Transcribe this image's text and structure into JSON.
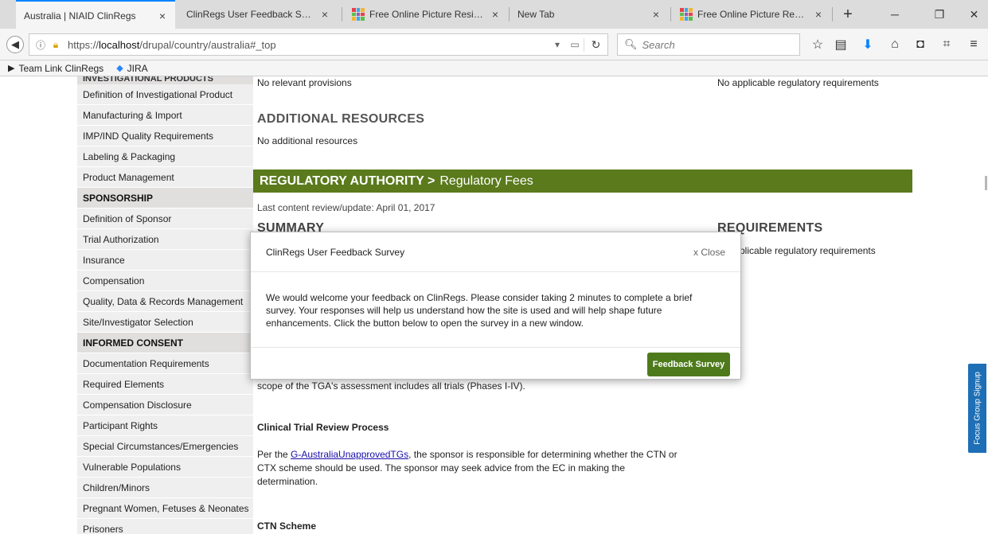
{
  "browser": {
    "tabs": [
      {
        "title": "Australia | NIAID ClinRegs",
        "active": true
      },
      {
        "title": "ClinRegs User Feedback Surve...",
        "active": false
      },
      {
        "title": "Free Online Picture Resize...",
        "active": false,
        "favicon": "grid-icon"
      },
      {
        "title": "New Tab",
        "active": false
      },
      {
        "title": "Free Online Picture Resize...",
        "active": false,
        "favicon": "grid-icon"
      }
    ],
    "close_glyph": "×",
    "new_tab_glyph": "+",
    "url_prefix": "https://",
    "url_host": "localhost",
    "url_path": "/drupal/country/australia#_top",
    "search_placeholder": "Search",
    "bookmarks": [
      {
        "label": "Team Link ClinRegs",
        "icon": "arrow-folder-icon"
      },
      {
        "label": "JIRA",
        "icon": "jira-diamond-icon"
      }
    ]
  },
  "sidebar": {
    "cut_header": "INVESTIGATIONAL PRODUCTS",
    "items_a": [
      "Definition of Investigational Product",
      "Manufacturing & Import",
      "IMP/IND Quality Requirements",
      "Labeling & Packaging",
      "Product Management"
    ],
    "header_sponsorship": "SPONSORSHIP",
    "items_b": [
      "Definition of Sponsor",
      "Trial Authorization",
      "Insurance",
      "Compensation",
      "Quality, Data & Records Management",
      "Site/Investigator Selection"
    ],
    "header_consent": "INFORMED CONSENT",
    "items_c": [
      "Documentation Requirements",
      "Required Elements",
      "Compensation Disclosure",
      "Participant Rights",
      "Special Circumstances/Emergencies",
      "Vulnerable Populations",
      "Children/Minors",
      "Pregnant Women, Fetuses & Neonates",
      "Prisoners"
    ]
  },
  "main": {
    "no_provisions": "No relevant provisions",
    "no_requirements_top": "No applicable regulatory requirements",
    "additional_resources_heading": "ADDITIONAL RESOURCES",
    "no_additional": "No additional resources",
    "section_bold": "REGULATORY AUTHORITY >",
    "section_rest": "Regulatory Fees",
    "last_review": "Last content review/update: April 01, 2017",
    "summary_heading": "SUMMARY",
    "requirements_heading": "REQUIREMENTS",
    "no_requirements_mid": "plicable regulatory requirements",
    "scope_text": "scope of the TGA's assessment includes all trials (Phases I-IV).",
    "review_process_heading": "Clinical Trial Review Process",
    "review_text_pre": "Per the ",
    "review_link": "G-AustraliaUnapprovedTGs",
    "review_text_line1": ", the sponsor is responsible for determining whether the CTN or",
    "review_text_line2": "CTX scheme should be used. The sponsor may seek advice from the EC in making the",
    "review_text_line3": "determination.",
    "ctn_heading": "CTN Scheme"
  },
  "modal": {
    "title": "ClinRegs User Feedback Survey",
    "close_label": "x Close",
    "body_line1": "We would welcome your feedback on ClinRegs. Please consider taking 2 minutes to complete a brief",
    "body_line2": "survey. Your responses will help us understand how the site is used and will help shape future",
    "body_line3": "enhancements. Click the button below to open the survey in a new window.",
    "button_label": "Feedback Survey"
  },
  "focus_tab_label": "Focus Group Signup",
  "colors": {
    "section_bar": "#5a7a1c",
    "survey_button": "#4e7a1b",
    "focus_tab": "#1e6fb5",
    "active_tab_accent": "#0a84ff"
  }
}
